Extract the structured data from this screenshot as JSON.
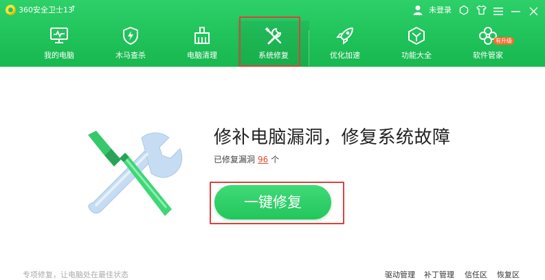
{
  "app": {
    "title": "360安全卫士13",
    "upgrade_arrow": "↑"
  },
  "titlebar": {
    "login_text": "未登录",
    "icons": [
      "user-icon",
      "skin-icon",
      "shirt-icon",
      "menu-icon",
      "minimize-icon",
      "close-icon"
    ]
  },
  "nav": {
    "items": [
      {
        "label": "我的电脑",
        "icon": "monitor-icon"
      },
      {
        "label": "木马查杀",
        "icon": "shield-icon"
      },
      {
        "label": "电脑清理",
        "icon": "broom-icon"
      },
      {
        "label": "系统修复",
        "icon": "wrench-screwdriver-icon",
        "active": true
      },
      {
        "label": "优化加速",
        "icon": "rocket-icon"
      },
      {
        "label": "功能大全",
        "icon": "cube-icon"
      },
      {
        "label": "软件管家",
        "icon": "flower-icon",
        "badge": "有升级"
      }
    ]
  },
  "main": {
    "title": "修补电脑漏洞，修复系统故障",
    "sub_prefix": "已修复漏洞",
    "fixed_count": "96",
    "sub_unit": "个",
    "fix_button": "一键修复"
  },
  "footer": {
    "left_text": "专项修复，让电脑处在最佳状态",
    "links": [
      "驱动管理",
      "补丁管理",
      "信任区",
      "恢复区"
    ]
  },
  "colors": {
    "brand_green": "#22c35c",
    "highlight_red": "#d9423c",
    "count_red": "#e34a31"
  }
}
